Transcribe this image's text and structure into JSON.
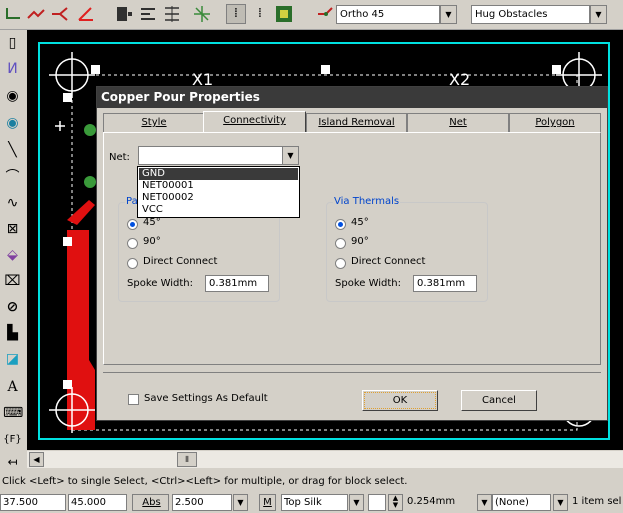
{
  "toolbar": {
    "route_mode": "Ortho 45",
    "obstacle_mode": "Hug Obstacles"
  },
  "canvas": {
    "designators": [
      "X1",
      "X2"
    ]
  },
  "dialog": {
    "title": "Copper Pour Properties",
    "tabs": [
      "Style",
      "Connectivity",
      "Island Removal",
      "Net",
      "Polygon"
    ],
    "active_tab": "Connectivity",
    "net_label": "Net:",
    "net_value": "",
    "net_options": [
      "GND",
      "NET00001",
      "NET00002",
      "VCC"
    ],
    "pad_thermals": {
      "title": "Pad Thermals",
      "title_visible": "Pa",
      "options": [
        "45°",
        "90°",
        "Direct Connect"
      ],
      "selected": "45°",
      "spoke_label": "Spoke Width:",
      "spoke_value": "0.381mm"
    },
    "via_thermals": {
      "title": "Via Thermals",
      "options": [
        "45°",
        "90°",
        "Direct Connect"
      ],
      "selected": "45°",
      "spoke_label": "Spoke Width:",
      "spoke_value": "0.381mm"
    },
    "save_default_label": "Save Settings As Default",
    "ok_label": "OK",
    "cancel_label": "Cancel"
  },
  "status": {
    "message": "Click <Left> to single Select, <Ctrl><Left> for multiple, or drag for block select.",
    "x": "37.500",
    "y": "45.000",
    "abs_label": "Abs",
    "grid": "2.500",
    "m_label": "M",
    "layer": "Top Silk",
    "width": "0.254mm",
    "net": "(None)",
    "selection": "1 item sel"
  },
  "colors": {
    "canvas": "#000000",
    "board_outline": "#00e0e0",
    "copper": "#e01010",
    "dialog_title": "#3a3a3a",
    "group_title": "#0044cc"
  }
}
